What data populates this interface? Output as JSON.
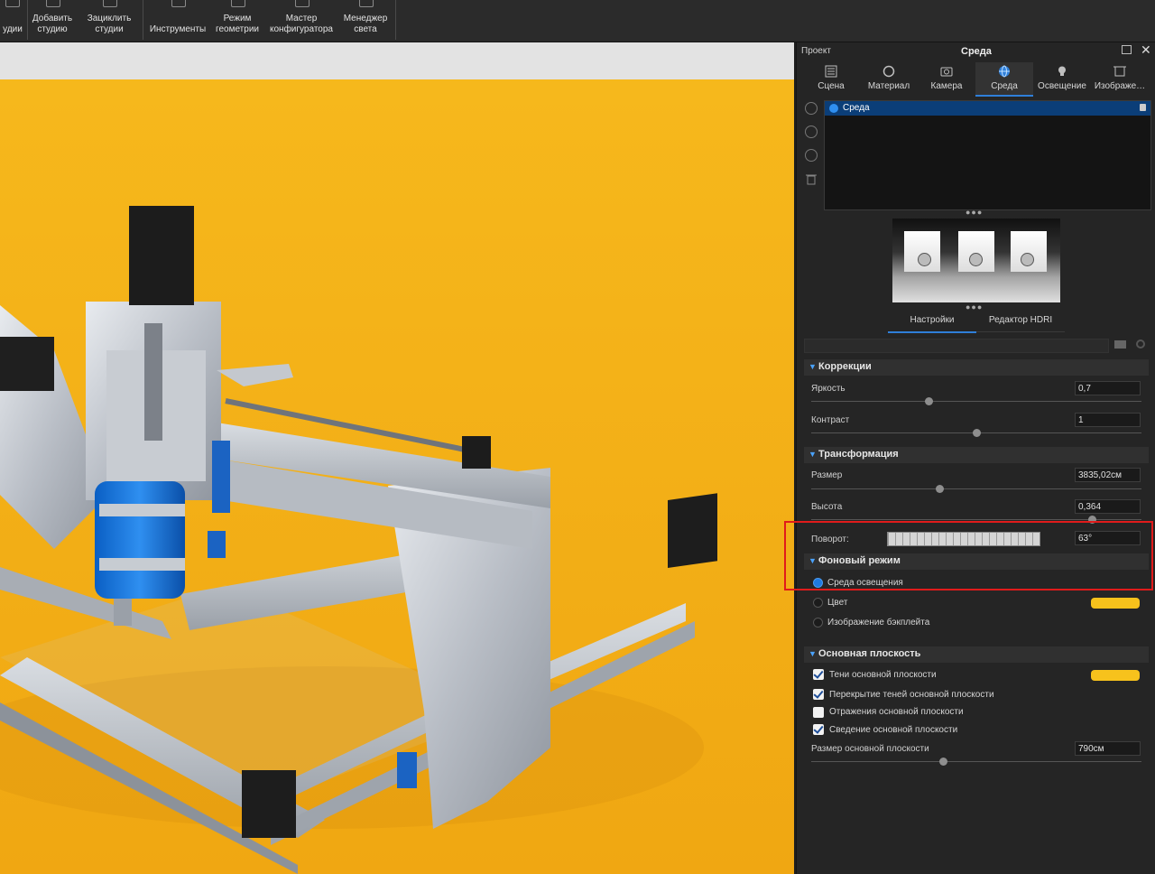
{
  "toolbar": {
    "items": [
      {
        "label": "удии"
      },
      {
        "label": "Добавить\nстудию"
      },
      {
        "label": "Зациклить\nстудии"
      },
      {
        "label": "Инструменты"
      },
      {
        "label": "Режим\nгеометрии"
      },
      {
        "label": "Мастер\nконфигуратора"
      },
      {
        "label": "Менеджер\nсвета"
      }
    ]
  },
  "panel": {
    "project_label": "Проект",
    "title": "Среда",
    "tabs": [
      {
        "label": "Сцена",
        "icon": "scene-icon"
      },
      {
        "label": "Материал",
        "icon": "material-icon"
      },
      {
        "label": "Камера",
        "icon": "camera-icon"
      },
      {
        "label": "Среда",
        "icon": "globe-icon",
        "active": true
      },
      {
        "label": "Освещение",
        "icon": "bulb-icon"
      },
      {
        "label": "Изображе…",
        "icon": "image-icon"
      }
    ],
    "env_list": {
      "selected": "Среда"
    },
    "subtabs": {
      "settings": "Настройки",
      "hdri_editor": "Редактор HDRI"
    },
    "sections": {
      "correction": {
        "title": "Коррекции",
        "brightness": {
          "label": "Яркость",
          "value": "0,7"
        },
        "contrast": {
          "label": "Контраст",
          "value": "1"
        }
      },
      "transform": {
        "title": "Трансформация",
        "size": {
          "label": "Размер",
          "value": "3835,02см"
        },
        "height": {
          "label": "Высота",
          "value": "0,364"
        },
        "rotation": {
          "label": "Поворот:",
          "value": "63°"
        }
      },
      "background": {
        "title": "Фоновый режим",
        "options": [
          {
            "label": "Среда освещения",
            "selected": true
          },
          {
            "label": "Цвет",
            "selected": false
          },
          {
            "label": "Изображение бэкплейта",
            "selected": false
          }
        ],
        "color": "#f7c21c"
      },
      "ground": {
        "title": "Основная плоскость",
        "checks": [
          {
            "label": "Тени основной плоскости",
            "checked": true
          },
          {
            "label": "Перекрытие теней основной плоскости",
            "checked": true
          },
          {
            "label": "Отражения основной плоскости",
            "checked": false
          },
          {
            "label": "Сведение основной плоскости",
            "checked": true
          }
        ],
        "shadow_color": "#f7c21c",
        "size": {
          "label": "Размер основной плоскости",
          "value": "790см"
        }
      }
    }
  },
  "colors": {
    "accent": "#2f7fd9",
    "highlight": "#e01b1b",
    "background": "#f4b81a"
  }
}
